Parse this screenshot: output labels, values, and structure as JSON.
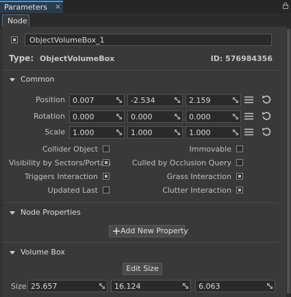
{
  "window": {
    "tab_title": "Parameters",
    "close_glyph": "×"
  },
  "subtab": {
    "label": "Node"
  },
  "node": {
    "enabled": true,
    "name": "ObjectVolumeBox_1",
    "type_label": "Type:",
    "type_value": "ObjectVolumeBox",
    "id_text": "ID: 576984356"
  },
  "common": {
    "header": "Common",
    "rows": [
      {
        "label": "Position",
        "values": [
          "0.007",
          "-2.534",
          "2.159"
        ]
      },
      {
        "label": "Rotation",
        "values": [
          "0.000",
          "0.000",
          "0.000"
        ]
      },
      {
        "label": "Scale",
        "values": [
          "1.000",
          "1.000",
          "1.000"
        ]
      }
    ],
    "flags_left": [
      {
        "label": "Collider Object",
        "checked": false
      },
      {
        "label": "Visibility by Sectors/Portals",
        "checked": true
      },
      {
        "label": "Triggers Interaction",
        "checked": true
      },
      {
        "label": "Updated Last",
        "checked": false
      }
    ],
    "flags_right": [
      {
        "label": "Immovable",
        "checked": false
      },
      {
        "label": "Culled by Occlusion Query",
        "checked": false
      },
      {
        "label": "Grass Interaction",
        "checked": true
      },
      {
        "label": "Clutter Interaction",
        "checked": true
      }
    ]
  },
  "node_properties": {
    "header": "Node Properties",
    "add_button": "Add New Property"
  },
  "volume_box": {
    "header": "Volume Box",
    "edit_button": "Edit Size",
    "size_label": "Size",
    "size_values": [
      "25.657",
      "16.124",
      "6.063"
    ]
  },
  "icons": {
    "lock": "lock-icon",
    "expand": "triangle-down-icon",
    "drag": "drag-arrow-icon",
    "menu": "hamburger-menu-icon",
    "reset": "reset-icon",
    "add": "plus-icon"
  },
  "colors": {
    "accent": "#4a9be0",
    "background": "#393939",
    "field": "#2a2a2a"
  }
}
